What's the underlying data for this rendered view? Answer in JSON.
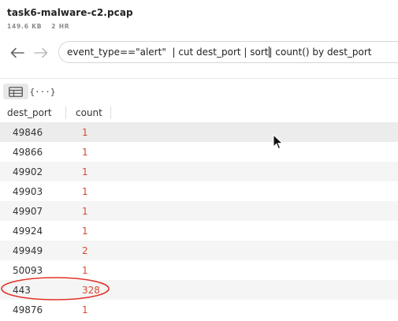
{
  "file": {
    "title": "task6-malware-c2.pcap",
    "size": "149.6 KB",
    "duration": "2 HR"
  },
  "nav": {
    "back_icon": "arrow-left-icon",
    "forward_icon": "arrow-right-icon"
  },
  "query": {
    "before_caret": "event_type==\"alert\"  | cut dest_port | sort",
    "after_caret": "| count() by dest_port"
  },
  "view_toggle": {
    "table_icon": "table-icon",
    "json_label": "{···}"
  },
  "table": {
    "columns": [
      "dest_port",
      "count"
    ],
    "rows": [
      {
        "dest_port": "49846",
        "count": "1"
      },
      {
        "dest_port": "49866",
        "count": "1"
      },
      {
        "dest_port": "49902",
        "count": "1"
      },
      {
        "dest_port": "49903",
        "count": "1"
      },
      {
        "dest_port": "49907",
        "count": "1"
      },
      {
        "dest_port": "49924",
        "count": "1"
      },
      {
        "dest_port": "49949",
        "count": "2"
      },
      {
        "dest_port": "50093",
        "count": "1"
      },
      {
        "dest_port": "443",
        "count": "328"
      },
      {
        "dest_port": "49876",
        "count": "1"
      }
    ]
  },
  "annotation": {
    "color": "#e0322a",
    "highlighted_row": "443"
  },
  "colors": {
    "count_value": "#d9482f"
  }
}
